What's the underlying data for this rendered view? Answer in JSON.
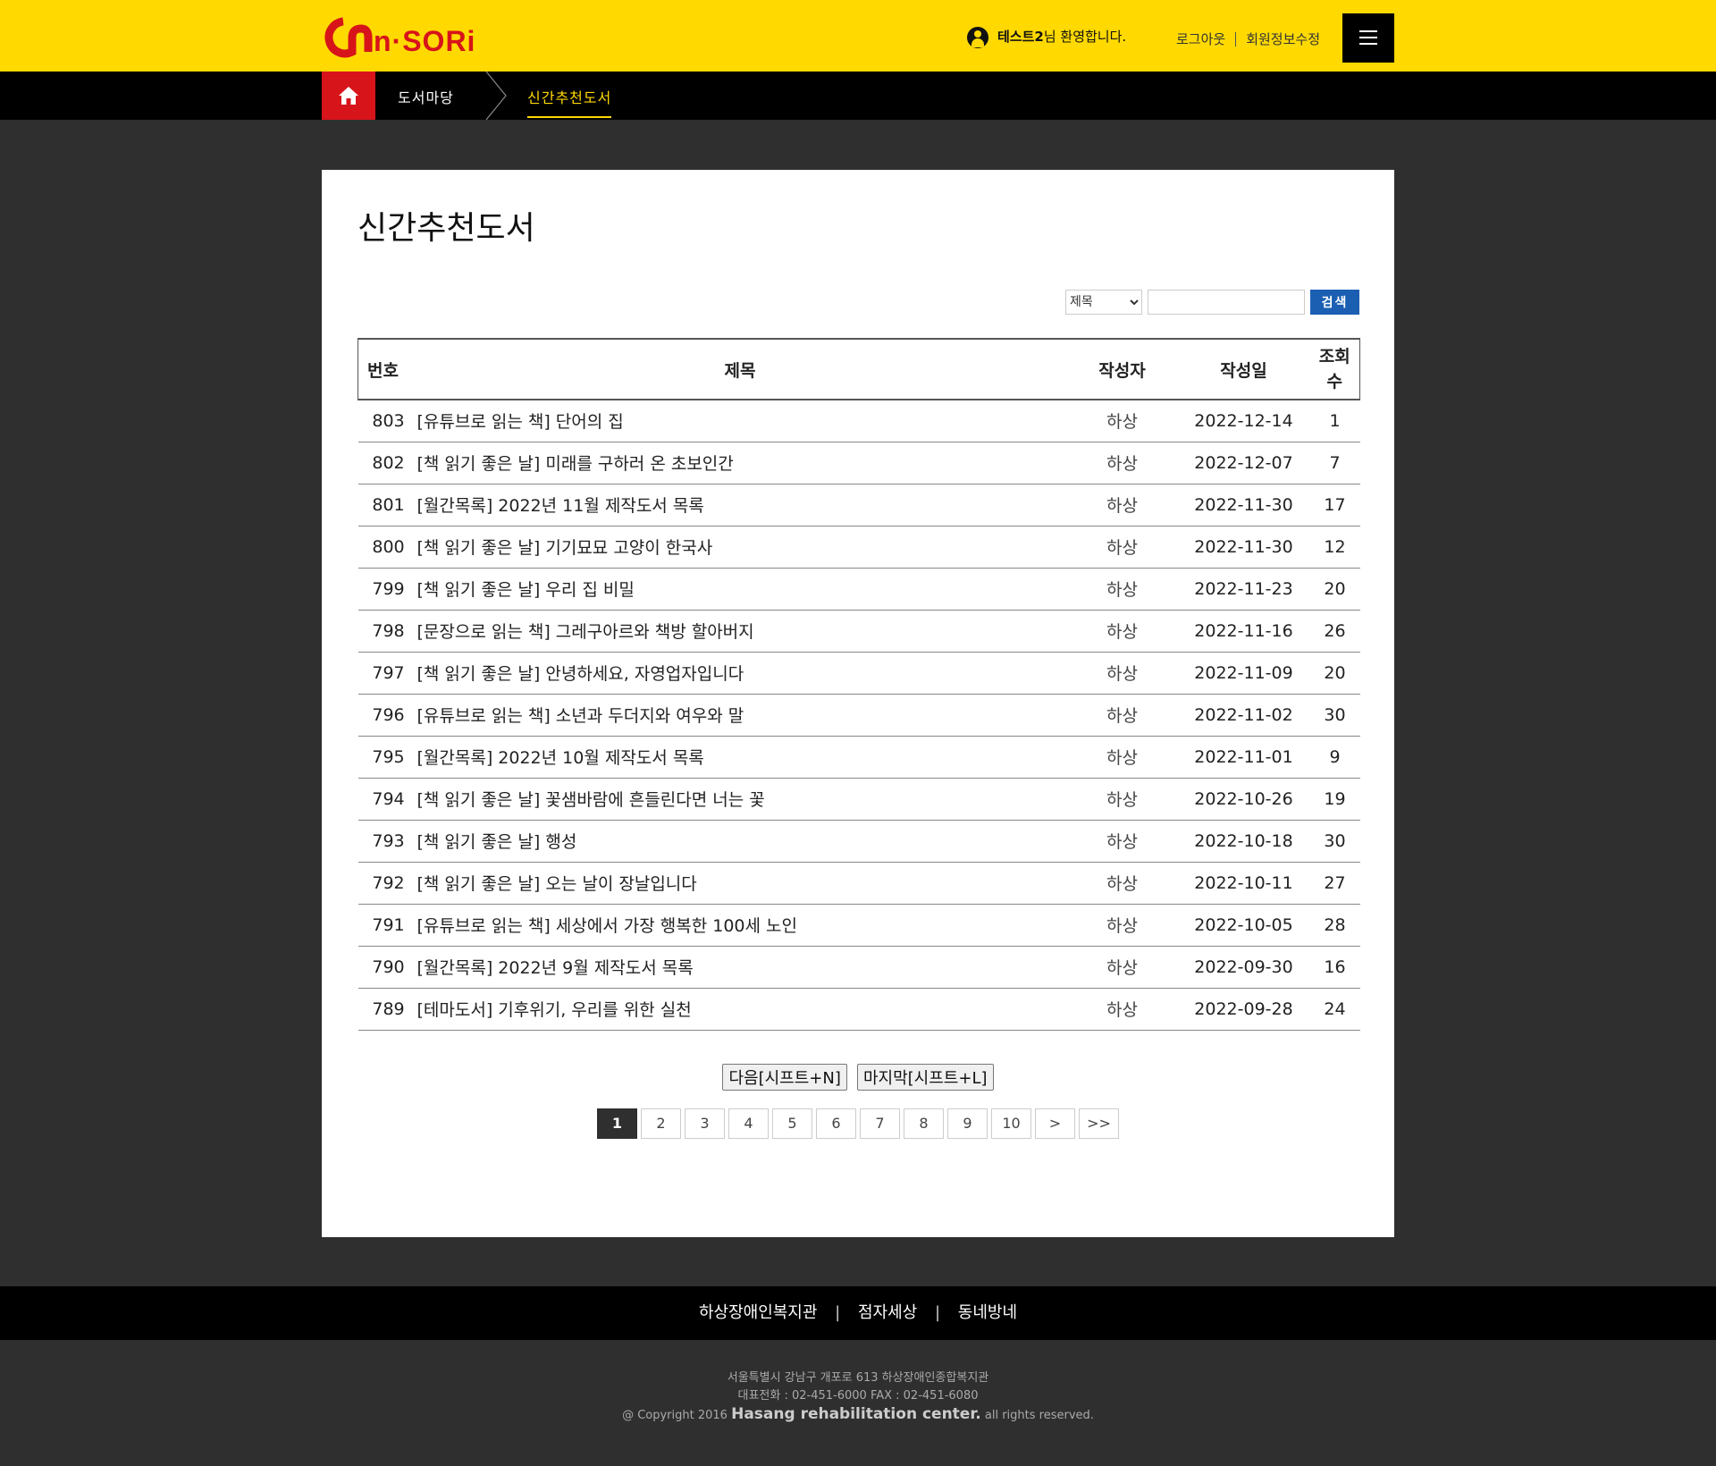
{
  "header": {
    "logo_text": "n·SORi",
    "welcome_user": "테스트2",
    "welcome_suffix": "님 환영합니다.",
    "logout_label": "로그아웃",
    "edit_profile_label": "회원정보수정"
  },
  "breadcrumb": {
    "level1": "도서마당",
    "level2": "신간추천도서"
  },
  "page": {
    "title": "신간추천도서"
  },
  "search": {
    "field_options": [
      "제목"
    ],
    "selected_field": "제목",
    "query": "",
    "button_label": "검색"
  },
  "table": {
    "headers": {
      "num": "번호",
      "title": "제목",
      "author": "작성자",
      "date": "작성일",
      "views": "조회수"
    },
    "rows": [
      {
        "num": "803",
        "title": "[유튜브로 읽는 책] 단어의 집",
        "author": "하상",
        "date": "2022-12-14",
        "views": "1"
      },
      {
        "num": "802",
        "title": "[책 읽기 좋은 날] 미래를 구하러 온 초보인간",
        "author": "하상",
        "date": "2022-12-07",
        "views": "7"
      },
      {
        "num": "801",
        "title": "[월간목록] 2022년 11월 제작도서 목록",
        "author": "하상",
        "date": "2022-11-30",
        "views": "17"
      },
      {
        "num": "800",
        "title": "[책 읽기 좋은 날] 기기묘묘 고양이 한국사",
        "author": "하상",
        "date": "2022-11-30",
        "views": "12"
      },
      {
        "num": "799",
        "title": "[책 읽기 좋은 날] 우리 집 비밀",
        "author": "하상",
        "date": "2022-11-23",
        "views": "20"
      },
      {
        "num": "798",
        "title": "[문장으로 읽는 책] 그레구아르와 책방 할아버지",
        "author": "하상",
        "date": "2022-11-16",
        "views": "26"
      },
      {
        "num": "797",
        "title": "[책 읽기 좋은 날] 안녕하세요, 자영업자입니다",
        "author": "하상",
        "date": "2022-11-09",
        "views": "20"
      },
      {
        "num": "796",
        "title": "[유튜브로 읽는 책] 소년과 두더지와 여우와 말",
        "author": "하상",
        "date": "2022-11-02",
        "views": "30"
      },
      {
        "num": "795",
        "title": "[월간목록] 2022년 10월 제작도서 목록",
        "author": "하상",
        "date": "2022-11-01",
        "views": "9"
      },
      {
        "num": "794",
        "title": "[책 읽기 좋은 날] 꽃샘바람에 흔들린다면 너는 꽃",
        "author": "하상",
        "date": "2022-10-26",
        "views": "19"
      },
      {
        "num": "793",
        "title": "[책 읽기 좋은 날] 행성",
        "author": "하상",
        "date": "2022-10-18",
        "views": "30"
      },
      {
        "num": "792",
        "title": "[책 읽기 좋은 날] 오는 날이 장날입니다",
        "author": "하상",
        "date": "2022-10-11",
        "views": "27"
      },
      {
        "num": "791",
        "title": "[유튜브로 읽는 책] 세상에서 가장 행복한 100세 노인",
        "author": "하상",
        "date": "2022-10-05",
        "views": "28"
      },
      {
        "num": "790",
        "title": "[월간목록] 2022년 9월 제작도서 목록",
        "author": "하상",
        "date": "2022-09-30",
        "views": "16"
      },
      {
        "num": "789",
        "title": "[테마도서] 기후위기, 우리를 위한 실천",
        "author": "하상",
        "date": "2022-09-28",
        "views": "24"
      }
    ]
  },
  "navigation": {
    "next_label": "다음[시프트+N]",
    "last_label": "마지막[시프트+L]"
  },
  "pagination": {
    "current": "1",
    "pages": [
      "1",
      "2",
      "3",
      "4",
      "5",
      "6",
      "7",
      "8",
      "9",
      "10"
    ],
    "next_label": ">",
    "last_label": ">>"
  },
  "footer": {
    "links": [
      "하상장애인복지관",
      "점자세상",
      "동네방네"
    ],
    "separator": "|",
    "address": "서울특별시 강남구 개포로 613 하상장애인종합복지관",
    "phone": "대표전화 : 02-451-6000 FAX : 02-451-6080",
    "copyright_prefix": "@ Copyright 2016",
    "copyright_brand": "Hasang rehabilitation center.",
    "copyright_suffix": "all rights reserved."
  },
  "colors": {
    "header_bg": "#ffd900",
    "brand_red": "#d7141a",
    "search_button": "#1b5fb3",
    "page_bg": "#2f2f2f"
  }
}
